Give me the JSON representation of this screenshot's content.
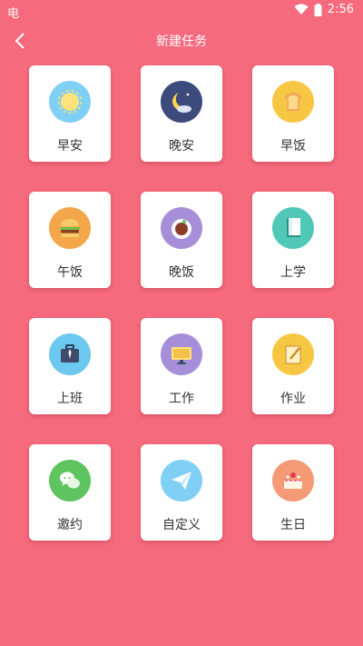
{
  "status": {
    "time": "2:56",
    "left_glyph": "电"
  },
  "header": {
    "title": "新建任务"
  },
  "tasks": [
    {
      "label": "早安",
      "icon": "sun-icon",
      "color": "#7fd0f4"
    },
    {
      "label": "晚安",
      "icon": "moon-icon",
      "color": "#3d4a7c"
    },
    {
      "label": "早饭",
      "icon": "toast-icon",
      "color": "#f7c744"
    },
    {
      "label": "午饭",
      "icon": "burger-icon",
      "color": "#f4a64a"
    },
    {
      "label": "晚饭",
      "icon": "dinner-plate-icon",
      "color": "#a78ed8"
    },
    {
      "label": "上学",
      "icon": "book-icon",
      "color": "#4fc8b8"
    },
    {
      "label": "上班",
      "icon": "briefcase-icon",
      "color": "#6cc8ee"
    },
    {
      "label": "工作",
      "icon": "monitor-icon",
      "color": "#a78ed8"
    },
    {
      "label": "作业",
      "icon": "homework-icon",
      "color": "#f7c744"
    },
    {
      "label": "邀约",
      "icon": "chat-icon",
      "color": "#5ec45f"
    },
    {
      "label": "自定义",
      "icon": "paper-plane-icon",
      "color": "#7fd0f4"
    },
    {
      "label": "生日",
      "icon": "cake-icon",
      "color": "#f49a76"
    }
  ]
}
